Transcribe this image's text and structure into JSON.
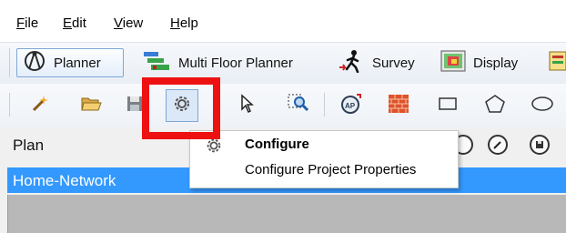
{
  "menubar": {
    "items": [
      {
        "mnemonic": "F",
        "rest": "ile"
      },
      {
        "mnemonic": "E",
        "rest": "dit"
      },
      {
        "mnemonic": "V",
        "rest": "iew"
      },
      {
        "mnemonic": "H",
        "rest": "elp"
      }
    ]
  },
  "modes": {
    "planner": "Planner",
    "multi_floor": "Multi Floor Planner",
    "survey": "Survey",
    "display": "Display"
  },
  "toolbar": {
    "tools": [
      "new-icon",
      "open-folder-icon",
      "save-icon",
      "gear-icon",
      "pointer-icon",
      "zoom-select-icon",
      "access-point-icon",
      "wall-brick-icon",
      "rectangle-icon",
      "polygon-icon",
      "ellipse-icon"
    ]
  },
  "plan": {
    "title": "Plan",
    "selected_item": "Home-Network"
  },
  "context_menu": {
    "configure": "Configure",
    "configure_project": "Configure Project Properties"
  },
  "colors": {
    "highlight": "#ee1111",
    "selection": "#3399ff"
  }
}
